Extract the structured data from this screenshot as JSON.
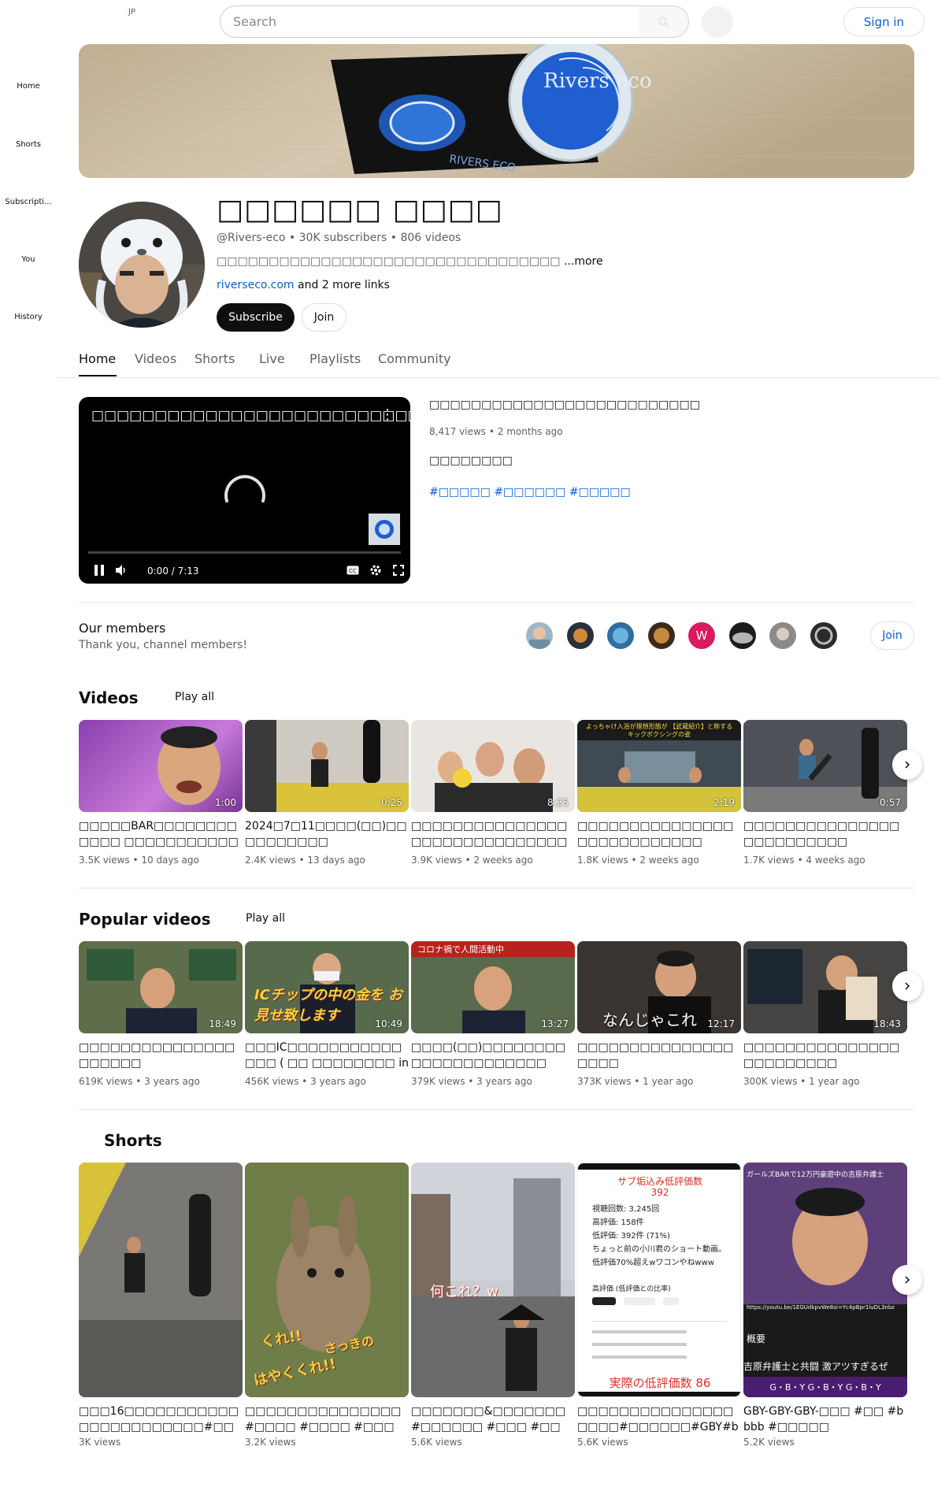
{
  "header": {
    "region": "JP",
    "search_placeholder": "Search",
    "signin_label": "Sign in"
  },
  "sidebar": {
    "items": [
      {
        "label": "Home"
      },
      {
        "label": "Shorts"
      },
      {
        "label": "Subscripti..."
      },
      {
        "label": "You"
      },
      {
        "label": "History"
      }
    ]
  },
  "banner": {
    "brand_text": "Rivers eco"
  },
  "channel": {
    "name": "□□□□□□ □□□□",
    "meta": "@Rivers-eco • 30K subscribers • 806 videos",
    "description": "□□□□□□□□□□□□□□□□□□□□□□□□□□□□□□□□□ ",
    "description_more": "...more",
    "link_text": "riverseco.com",
    "link_suffix": " and 2 more links",
    "subscribe_label": "Subscribe",
    "join_label": "Join"
  },
  "tabs": [
    {
      "label": "Home"
    },
    {
      "label": "Videos"
    },
    {
      "label": "Shorts"
    },
    {
      "label": "Live"
    },
    {
      "label": "Playlists"
    },
    {
      "label": "Community"
    }
  ],
  "featured": {
    "player_title": "□□□□□□□□□□□□□□□□□□□□□□□□□□",
    "time": "0:00 / 7:13",
    "progress": 0,
    "title": "□□□□□□□□□□□□□□□□□□□□□□□□□□",
    "meta": "8,417 views • 2 months ago",
    "description": "□□□□□□□□",
    "tags": "#□□□□□ #□□□□□□ #□□□□□"
  },
  "members": {
    "title": "Our members",
    "subtitle": "Thank you, channel members!",
    "join_label": "Join",
    "avatar_letter": "W",
    "avatar_letter_color": "#d81b60"
  },
  "videos_shelf": {
    "title": "Videos",
    "play_all": "Play all",
    "items": [
      {
        "title": "□□□□□BAR□□□□□□□□□□□□ □□□□□□□□□□□□(□□:□□□ / □□:□□)",
        "duration": "1:00",
        "meta": "3.5K views • 10 days ago"
      },
      {
        "title": "2024□7□11□□□□(□□)□□□□□□□□□□",
        "duration": "0:25",
        "meta": "2.4K views • 13 days ago"
      },
      {
        "title": "□□□□□□□□□□□□□□□□□□□□□□□□□□□□□□□□□□□□□□",
        "duration": "8:25",
        "meta": "3.9K views • 2 weeks ago"
      },
      {
        "title": "□□□□□□□□□□□□□□□□□□□□□□□□□□□",
        "duration": "2:19",
        "meta": "1.8K views • 2 weeks ago"
      },
      {
        "title": "□□□□□□□□□□□□□□□□□□□□□□□□□",
        "duration": "0:57",
        "meta": "1.7K views • 4 weeks ago"
      }
    ]
  },
  "popular_shelf": {
    "title": "Popular videos",
    "play_all": "Play all",
    "items": [
      {
        "title": "□□□□□□□□□□□□□□□□□□□□□",
        "duration": "18:49",
        "meta": "619K views • 3 years ago"
      },
      {
        "title": "□□□IC□□□□□□□□□□□□□□ ( □□ □□□□□□□□ in □□□ □□□□□...",
        "duration": "10:49",
        "meta": "456K views • 3 years ago"
      },
      {
        "title": "□□□□(□□)□□□□□□□□□□□□□□□□□□□□□",
        "duration": "13:27",
        "meta": "379K views • 3 years ago"
      },
      {
        "title": "□□□□□□□□□□□□□□□□□□□",
        "duration": "12:17",
        "meta": "373K views • 1 year ago"
      },
      {
        "title": "□□□□□□□□□□□□□□□□□□□□□□□□",
        "duration": "18:43",
        "meta": "300K views • 1 year ago"
      }
    ]
  },
  "shorts_shelf": {
    "title": "Shorts",
    "items": [
      {
        "title": "□□□16□□□□□□□□□□□□□□□□□□□□□□□#□□□□□□□□□□□□□ #□...",
        "meta": "3K views"
      },
      {
        "title": "□□□□□□□□□□□□□□□ #□□□□ #□□□□ #□□□",
        "meta": "3.2K views"
      },
      {
        "title": "□□□□□□□&□□□□□□□ #□□□□□□ #□□□ #□□",
        "meta": "5.6K views"
      },
      {
        "title": "□□□□□□□□□□□□□□□□□□□#□□□□□□#GBY#bbbb",
        "meta": "5.6K views"
      },
      {
        "title": "GBY-GBY-GBY-□□□ #□□ #bbbb #□□□□□",
        "meta": "5.2K views"
      }
    ]
  },
  "thumb_overlays": {
    "popular_2": "ICチップの中の金を お見せ致します",
    "popular_4": "なんじゃこれ",
    "short_3": "何これ？w",
    "short_2a": "くれ!!",
    "short_2b": "はやくくれ!!",
    "short_2c": "さっきの",
    "short_4_title": "サブ垢込み低評価数",
    "short_4_num": "392",
    "short_4_line1": "視聴回数: 3,245回",
    "short_4_line2": "高評価: 158件",
    "short_4_line3": "低評価: 392件 (71%)",
    "short_4_line4": "ちょっと前の小川君のショート動画。",
    "short_4_line5": "低評価70%超えwワコンやねwww",
    "short_4_table": "高評価 (低評価との比率)",
    "short_4_bottom": "実際の低評価数 86",
    "short_5_top": "ガールズBARで12万円豪遊中の吉原弁護士",
    "short_5_mid": "概要",
    "short_5_bottom": "吉原弁護士と共闘 激アツすぎるぜ",
    "short_5_band": "G・B・Y G・B・Y G・B・Y",
    "short_5_url": "https://youtu.be/1EGUdkpvWe8si=Yc4pBpr1luDL3nbz",
    "video_4_caption": "よっちゃけ入浴が理想形態が 【武蔵紹介】と称するキックボクシングの姿",
    "popular_3_caption": "コロナ禍で人間活動中"
  }
}
